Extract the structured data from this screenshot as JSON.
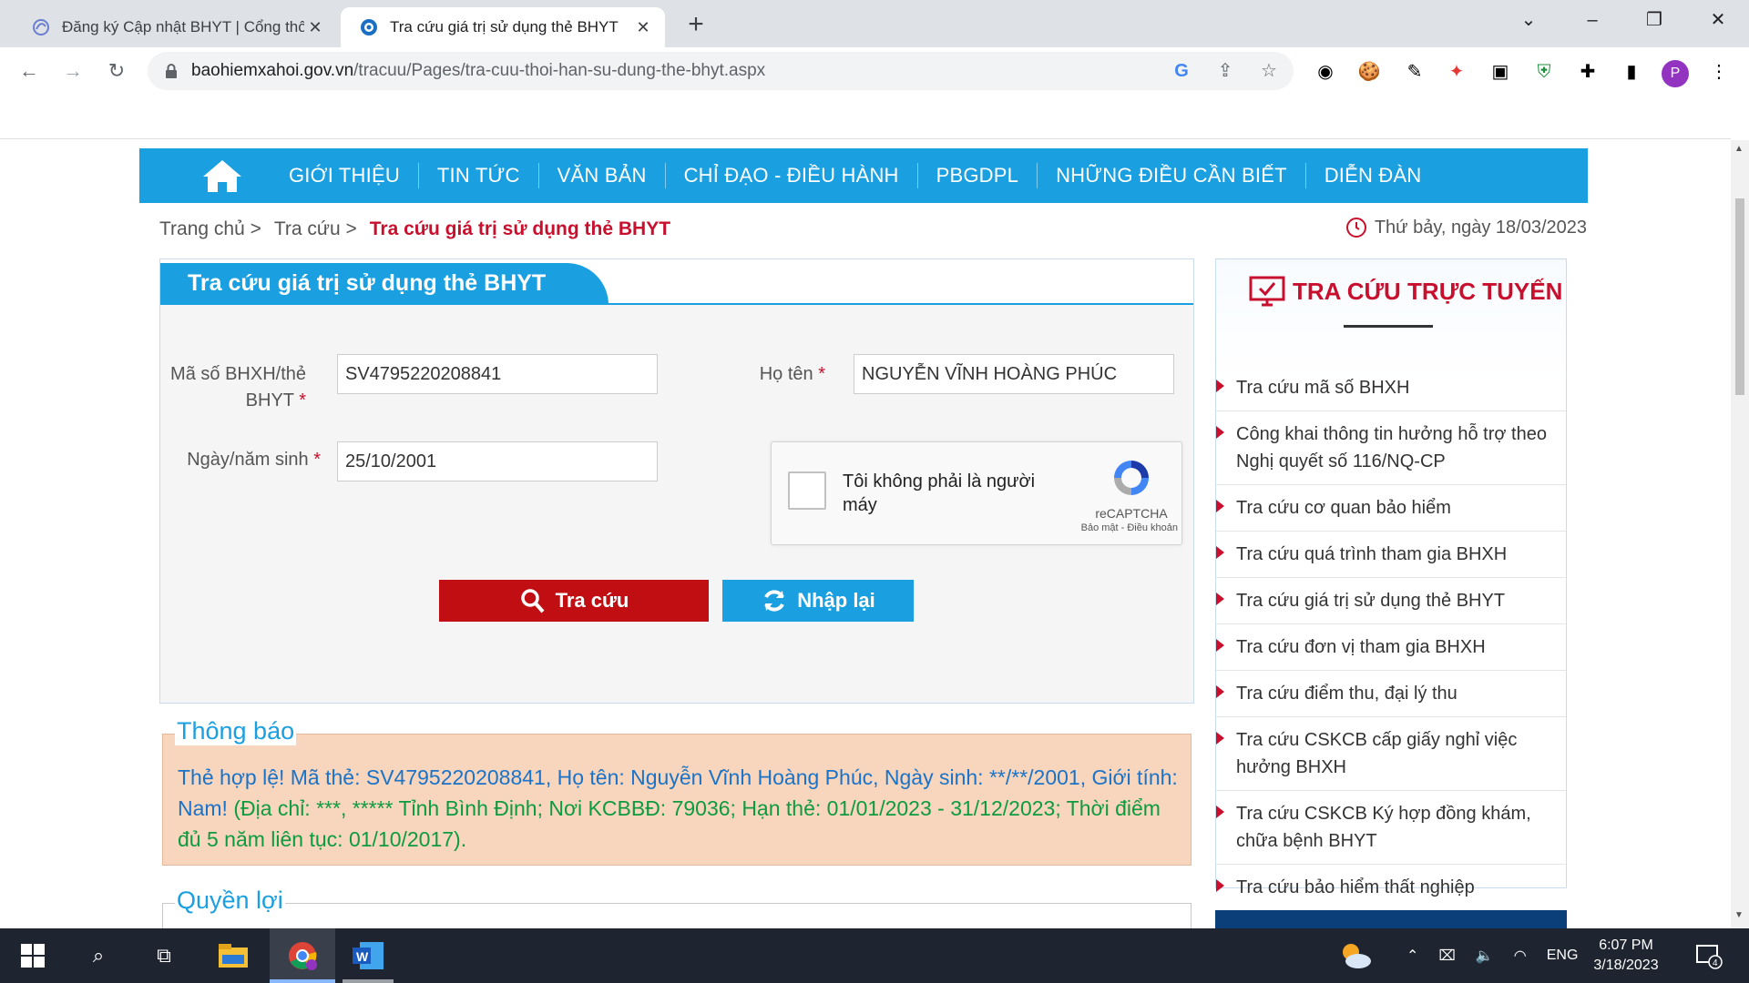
{
  "browser": {
    "tabs": [
      {
        "title": "Đăng ký Cập nhật BHYT | Cổng thông tin",
        "active": false
      },
      {
        "title": "Tra cứu giá trị sử dụng thẻ BHYT",
        "active": true
      }
    ],
    "url_host": "baohiemxahoi.gov.vn",
    "url_path": "/tracuu/Pages/tra-cuu-thoi-han-su-dung-the-bhyt.aspx",
    "profile_initial": "P",
    "new_tab_glyph": "+",
    "close_glyph": "✕"
  },
  "nav": {
    "items": [
      "GIỚI THIỆU",
      "TIN TỨC",
      "VĂN BẢN",
      "CHỈ ĐẠO - ĐIỀU HÀNH",
      "PBGDPL",
      "NHỮNG ĐIỀU CẦN BIẾT",
      "DIỄN ĐÀN"
    ]
  },
  "breadcrumb": {
    "home": "Trang chủ >",
    "section": "Tra cứu >",
    "current": "Tra cứu giá trị sử dụng thẻ BHYT"
  },
  "date_text": "Thứ bảy, ngày 18/03/2023",
  "form": {
    "title": "Tra cứu giá trị sử dụng thẻ BHYT",
    "id_label_line1": "Mã số BHXH/thẻ",
    "id_label_line2": "BHYT",
    "id_value": "SV4795220208841",
    "name_label": "Họ tên",
    "name_value": "NGUYỄN VĨNH HOÀNG PHÚC",
    "dob_label": "Ngày/năm sinh",
    "dob_value": "25/10/2001",
    "required_mark": "*",
    "captcha_text": "Tôi không phải là người máy",
    "captcha_brand": "reCAPTCHA",
    "captcha_terms": "Bảo mật - Điều khoản",
    "search_button": "Tra cứu",
    "reset_button": "Nhập lại"
  },
  "notice": {
    "legend": "Thông báo",
    "line_blue": "Thẻ hợp lệ! Mã thẻ: SV4795220208841, Họ tên: Nguyễn Vĩnh Hoàng Phúc, Ngày sinh: **/**/2001, Giới tính: Nam!",
    "line_green": "(Địa chỉ: ***, ***** Tỉnh Bình Định; Nơi KCBBĐ: 79036; Hạn thẻ: 01/01/2023 - 31/12/2023; Thời điểm đủ 5 năm liên tục: 01/10/2017)."
  },
  "rights": {
    "legend": "Quyền lợi"
  },
  "sidebar": {
    "title": "TRA CỨU TRỰC TUYẾN",
    "items": [
      "Tra cứu mã số BHXH",
      "Công khai thông tin hưởng hỗ trợ theo Nghị quyết số 116/NQ-CP",
      "Tra cứu cơ quan bảo hiểm",
      "Tra cứu quá trình tham gia BHXH",
      "Tra cứu giá trị sử dụng thẻ BHYT",
      "Tra cứu đơn vị tham gia BHXH",
      "Tra cứu điểm thu, đại lý thu",
      "Tra cứu CSKCB cấp giấy nghỉ việc hưởng BHXH",
      "Tra cứu CSKCB Ký hợp đồng khám, chữa bệnh BHYT",
      "Tra cứu bảo hiểm thất nghiệp"
    ]
  },
  "taskbar": {
    "lang": "ENG",
    "time": "6:07 PM",
    "date": "3/18/2023",
    "notif_count": "4",
    "word_letter": "W"
  },
  "colors": {
    "accent_blue": "#1a9fe0",
    "accent_red": "#c8102e",
    "notice_bg": "#f8d6be"
  }
}
